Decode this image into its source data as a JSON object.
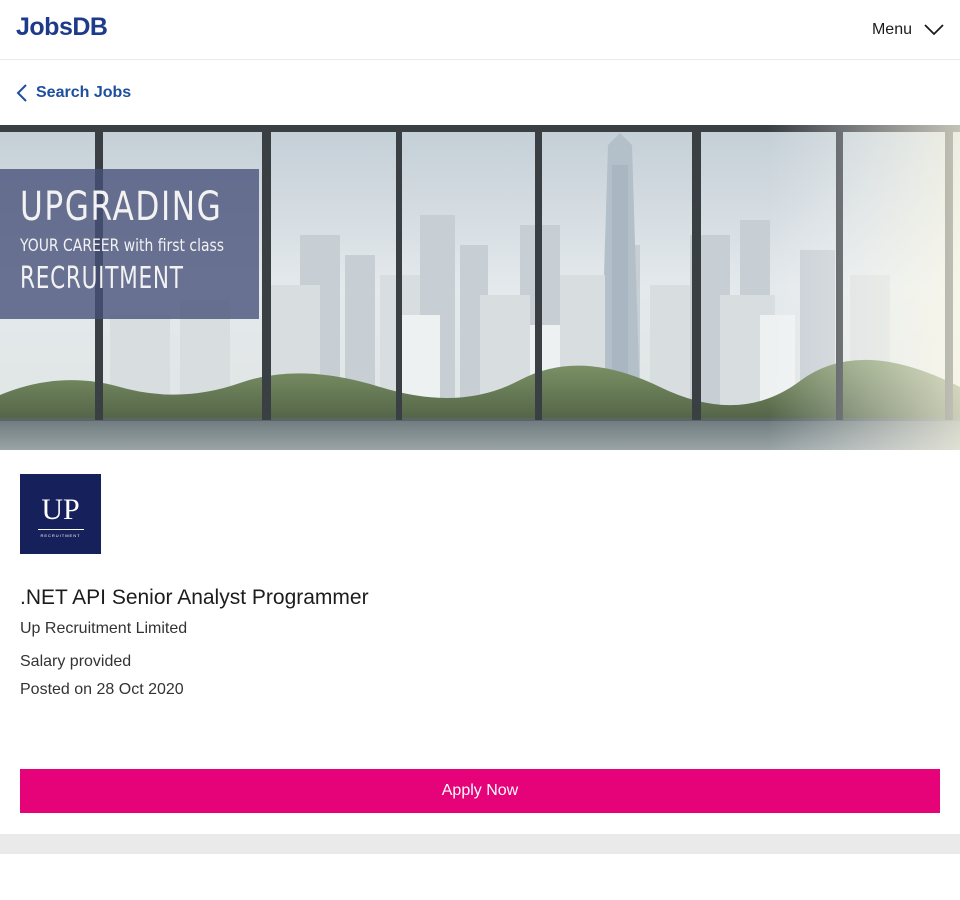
{
  "header": {
    "logo": "JobsDB",
    "menu_label": "Menu",
    "menu_icon": "chevron-down-icon"
  },
  "nav": {
    "back_label": "Search Jobs",
    "back_icon": "chevron-left-icon"
  },
  "banner": {
    "line1": "UPGRADING",
    "line2": "YOUR CAREER with first class",
    "line3": "RECRUITMENT"
  },
  "job": {
    "company_logo_text": "UP",
    "company_logo_sub": "RECRUITMENT",
    "title": ".NET API Senior Analyst Programmer",
    "company": "Up Recruitment Limited",
    "salary": "Salary provided",
    "posted": "Posted on 28 Oct 2020"
  },
  "actions": {
    "apply_label": "Apply Now"
  },
  "colors": {
    "brand_blue": "#1e3a8a",
    "link_blue": "#1d4fa0",
    "apply_pink": "#e60278",
    "company_logo_bg": "#16205a"
  }
}
